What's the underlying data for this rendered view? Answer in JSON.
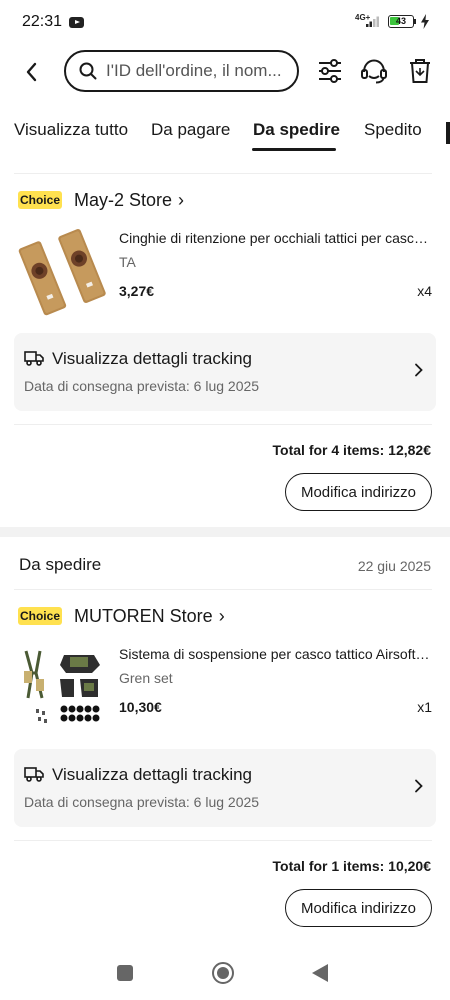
{
  "status_bar": {
    "time": "22:31",
    "network": "4G+",
    "battery": "43"
  },
  "search": {
    "placeholder": "I'ID dell'ordine, il nom..."
  },
  "tabs": [
    {
      "label": "Visualizza tutto"
    },
    {
      "label": "Da pagare"
    },
    {
      "label": "Da spedire"
    },
    {
      "label": "Spedito"
    }
  ],
  "orders": [
    {
      "badge": "Choice",
      "store": "May-2 Store",
      "product_title": "Cinghie di ritenzione per occhiali tattici per casco tattico",
      "variant": "TA",
      "price": "3,27€",
      "qty": "x4",
      "tracking_title": "Visualizza dettagli tracking",
      "tracking_date": "Data di consegna prevista: 6 lug 2025",
      "total": "Total for 4 items: 12,82€",
      "edit_label": "Modifica indirizzo"
    },
    {
      "status": "Da spedire",
      "date": "22 giu 2025",
      "badge": "Choice",
      "store": "MUTOREN Store",
      "product_title": "Sistema di sospensione per casco tattico Airsoft ...",
      "variant": "Gren set",
      "price": "10,30€",
      "qty": "x1",
      "tracking_title": "Visualizza dettagli tracking",
      "tracking_date": "Data di consegna prevista: 6 lug 2025",
      "total": "Total for 1 items: 10,20€",
      "edit_label": "Modifica indirizzo"
    }
  ]
}
